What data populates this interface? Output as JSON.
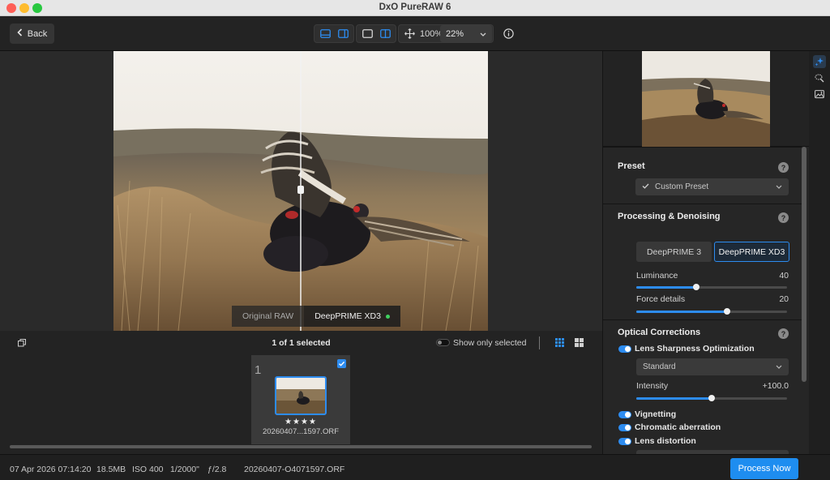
{
  "window": {
    "title": "DxO PureRAW 6"
  },
  "toolbar": {
    "back_label": "Back",
    "zoom_fit_label": "100%",
    "zoom_value": "22%"
  },
  "compare": {
    "left_label": "Original RAW",
    "right_label": "DeepPRIME XD3"
  },
  "filmstrip": {
    "selection_count": "1 of 1 selected",
    "show_only_selected_label": "Show only selected",
    "thumb": {
      "index": "1",
      "stars": "★★★★",
      "filename": "20260407...1597.ORF"
    }
  },
  "status": {
    "date": "07 Apr 2026 07:14:20",
    "size": "18.5MB",
    "iso": "ISO 400",
    "shutter": "1/2000\"",
    "aperture": "ƒ/2.8",
    "filename": "20260407-O4071597.ORF",
    "process_label": "Process Now"
  },
  "panel": {
    "preset": {
      "title": "Preset",
      "value": "Custom Preset"
    },
    "processing": {
      "title": "Processing & Denoising",
      "options": [
        "DeepPRIME 3",
        "DeepPRIME XD3"
      ],
      "active_option": 1,
      "luminance": {
        "label": "Luminance",
        "value": "40",
        "fraction": 0.4
      },
      "force_details": {
        "label": "Force details",
        "value": "20",
        "fraction": 0.6
      }
    },
    "optical": {
      "title": "Optical Corrections",
      "lens_sharpness": {
        "label": "Lens Sharpness Optimization",
        "enabled": true
      },
      "sharpness_mode": "Standard",
      "intensity": {
        "label": "Intensity",
        "value": "+100.0",
        "fraction": 0.5
      },
      "vignetting": {
        "label": "Vignetting",
        "enabled": true
      },
      "chromatic": {
        "label": "Chromatic aberration",
        "enabled": true
      },
      "distortion": {
        "label": "Lens distortion",
        "enabled": true
      }
    }
  },
  "colors": {
    "accent": "#2d8cf0",
    "panel": "#262626",
    "toolbar": "#232323"
  }
}
